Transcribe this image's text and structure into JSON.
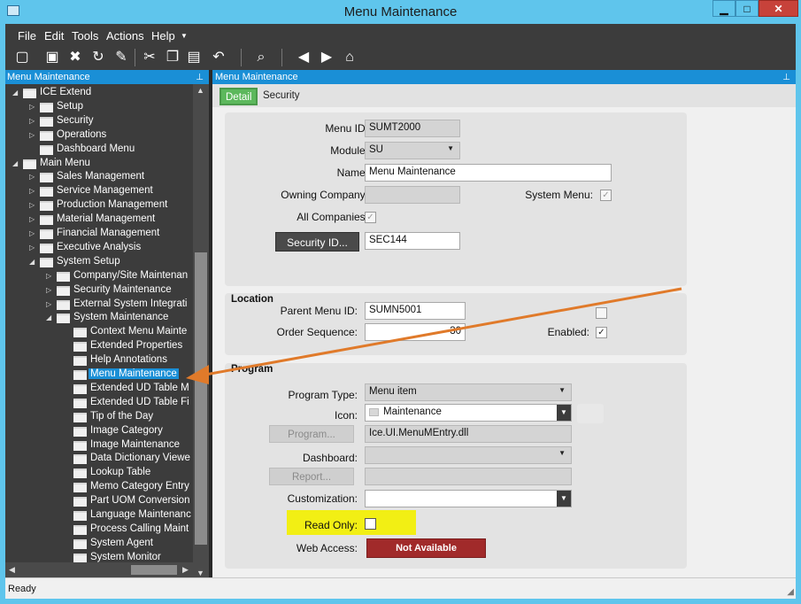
{
  "window": {
    "title": "Menu Maintenance",
    "min": "▁",
    "max": "□",
    "close": "✕"
  },
  "menubar": [
    "File",
    "Edit",
    "Tools",
    "Actions",
    "Help"
  ],
  "left_panel": {
    "title": "Menu Maintenance",
    "tree": [
      {
        "label": "ICE Extend",
        "level": 0,
        "tog": "◢"
      },
      {
        "label": "Setup",
        "level": 1,
        "tog": "▷"
      },
      {
        "label": "Security",
        "level": 1,
        "tog": "▷"
      },
      {
        "label": "Operations",
        "level": 1,
        "tog": "▷"
      },
      {
        "label": "Dashboard Menu",
        "level": 1,
        "tog": ""
      },
      {
        "label": "Main Menu",
        "level": 0,
        "tog": "◢"
      },
      {
        "label": "Sales Management",
        "level": 1,
        "tog": "▷"
      },
      {
        "label": "Service Management",
        "level": 1,
        "tog": "▷"
      },
      {
        "label": "Production Management",
        "level": 1,
        "tog": "▷"
      },
      {
        "label": "Material Management",
        "level": 1,
        "tog": "▷"
      },
      {
        "label": "Financial Management",
        "level": 1,
        "tog": "▷"
      },
      {
        "label": "Executive Analysis",
        "level": 1,
        "tog": "▷"
      },
      {
        "label": "System Setup",
        "level": 1,
        "tog": "◢"
      },
      {
        "label": "Company/Site Maintenan",
        "level": 2,
        "tog": "▷"
      },
      {
        "label": "Security Maintenance",
        "level": 2,
        "tog": "▷"
      },
      {
        "label": "External System Integrati",
        "level": 2,
        "tog": "▷"
      },
      {
        "label": "System Maintenance",
        "level": 2,
        "tog": "◢"
      },
      {
        "label": "Context Menu Mainte",
        "level": 3,
        "tog": ""
      },
      {
        "label": "Extended Properties",
        "level": 3,
        "tog": ""
      },
      {
        "label": "Help Annotations",
        "level": 3,
        "tog": ""
      },
      {
        "label": "Menu Maintenance",
        "level": 3,
        "tog": "",
        "selected": true
      },
      {
        "label": "Extended UD Table M",
        "level": 3,
        "tog": ""
      },
      {
        "label": "Extended UD Table Fi",
        "level": 3,
        "tog": ""
      },
      {
        "label": "Tip of the Day",
        "level": 3,
        "tog": ""
      },
      {
        "label": "Image Category",
        "level": 3,
        "tog": ""
      },
      {
        "label": "Image Maintenance",
        "level": 3,
        "tog": ""
      },
      {
        "label": "Data Dictionary Viewe",
        "level": 3,
        "tog": ""
      },
      {
        "label": "Lookup Table",
        "level": 3,
        "tog": ""
      },
      {
        "label": "Memo Category Entry",
        "level": 3,
        "tog": ""
      },
      {
        "label": "Part UOM Conversion",
        "level": 3,
        "tog": ""
      },
      {
        "label": "Language Maintenanc",
        "level": 3,
        "tog": ""
      },
      {
        "label": "Process Calling Maint",
        "level": 3,
        "tog": ""
      },
      {
        "label": "System Agent",
        "level": 3,
        "tog": ""
      },
      {
        "label": "System Monitor",
        "level": 3,
        "tog": ""
      }
    ]
  },
  "right_panel": {
    "title": "Menu Maintenance",
    "tabs": [
      "Detail",
      "Security"
    ],
    "general": {
      "menu_id_label": "Menu ID:",
      "menu_id": "SUMT2000",
      "module_label": "Module:",
      "module": "SU",
      "name_label": "Name:",
      "name": "Menu Maintenance",
      "owning_company_label": "Owning Company:",
      "owning_company": "",
      "system_menu_label": "System Menu:",
      "all_companies_label": "All Companies:",
      "security_button": "Security ID...",
      "security_id": "SEC144"
    },
    "location": {
      "title": "Location",
      "parent_menu_label": "Parent Menu ID:",
      "parent_menu": "SUMN5001",
      "order_seq_label": "Order Sequence:",
      "order_seq": "30",
      "enabled_label": "Enabled:"
    },
    "program": {
      "title": "Program",
      "type_label": "Program Type:",
      "type": "Menu item",
      "icon_label": "Icon:",
      "icon": "Maintenance",
      "program_button": "Program...",
      "program": "Ice.UI.MenuMEntry.dll",
      "dashboard_label": "Dashboard:",
      "dashboard": "",
      "report_button": "Report...",
      "report": "",
      "customization_label": "Customization:",
      "customization": "",
      "read_only_label": "Read Only:",
      "web_access_label": "Web Access:",
      "web_access": "Not Available"
    }
  },
  "status": {
    "text": "Ready"
  },
  "colors": {
    "accent": "#1a8fd6",
    "tab_active": "#5cb85c",
    "highlight": "#f2ef14",
    "arrow": "#e07a2a",
    "not_available": "#a12a2a"
  }
}
